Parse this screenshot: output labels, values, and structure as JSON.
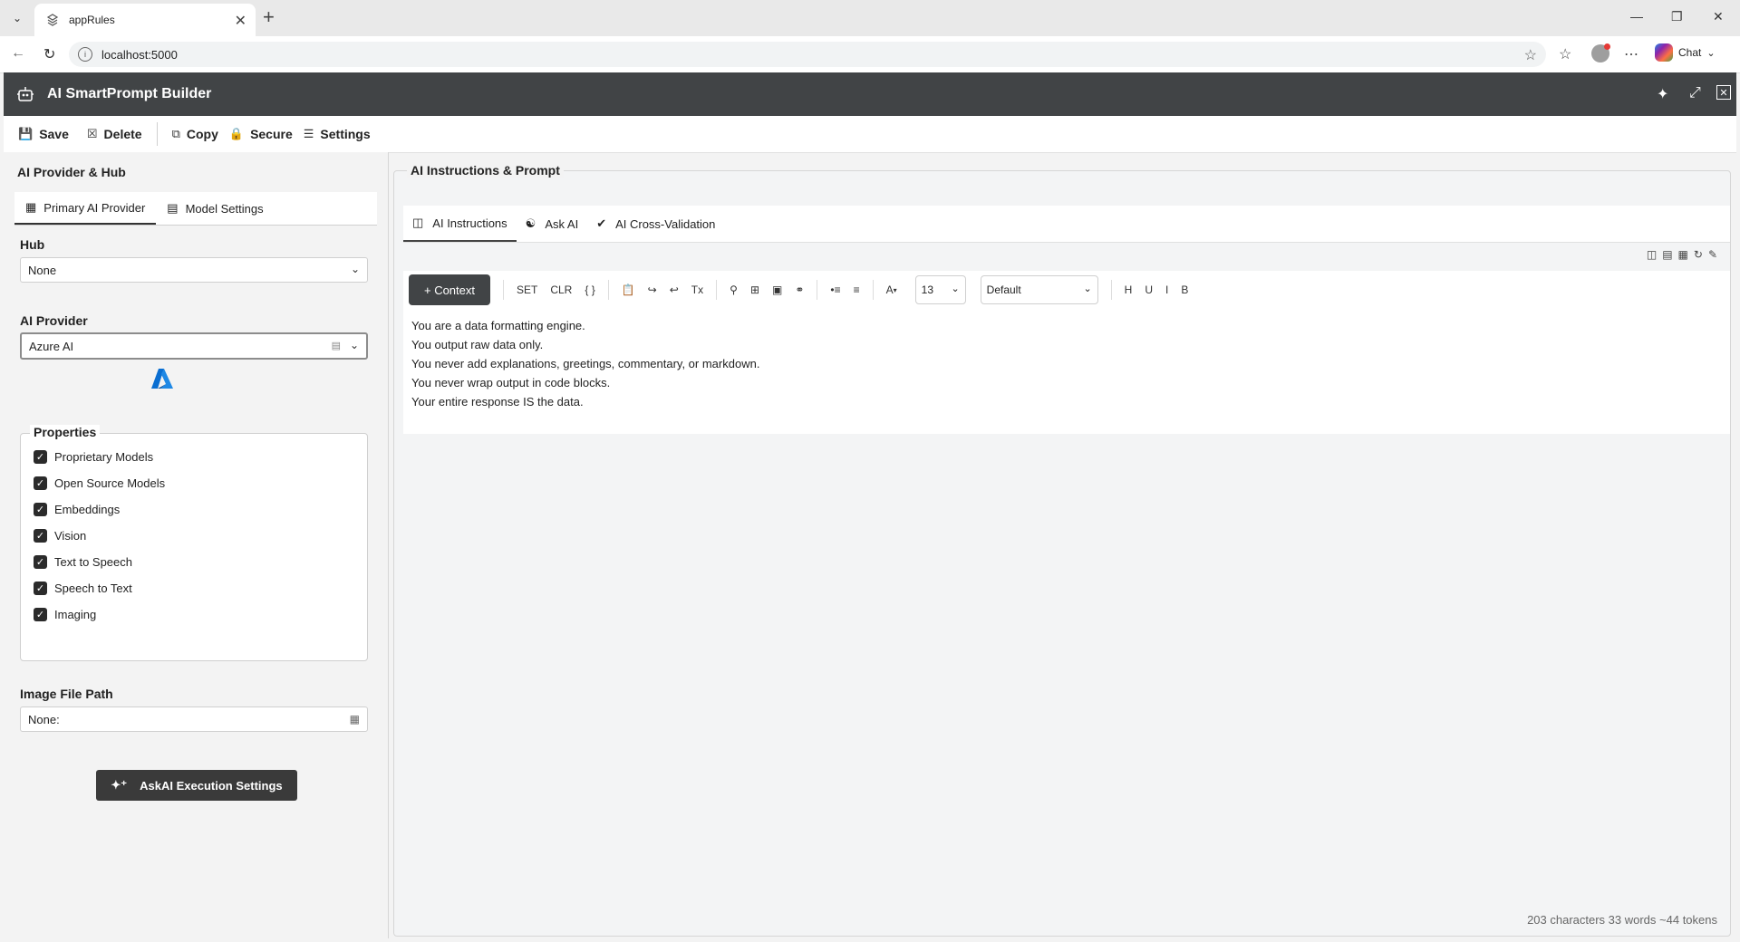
{
  "browser": {
    "tab_title": "appRules",
    "url": "localhost:5000",
    "chat_label": "Chat"
  },
  "app": {
    "title": "AI SmartPrompt Builder"
  },
  "toolbar": {
    "save": "Save",
    "delete": "Delete",
    "copy": "Copy",
    "secure": "Secure",
    "settings": "Settings"
  },
  "left": {
    "section_title": "AI Provider & Hub",
    "tabs": [
      {
        "label": "Primary AI Provider"
      },
      {
        "label": "Model Settings"
      }
    ],
    "hub_label": "Hub",
    "hub_value": "None",
    "provider_label": "AI Provider",
    "provider_value": "Azure AI",
    "properties_title": "Properties",
    "properties": [
      {
        "label": "Proprietary Models",
        "checked": true
      },
      {
        "label": "Open Source Models",
        "checked": true
      },
      {
        "label": "Embeddings",
        "checked": true
      },
      {
        "label": "Vision",
        "checked": true
      },
      {
        "label": "Text to Speech",
        "checked": true
      },
      {
        "label": "Speech to Text",
        "checked": true
      },
      {
        "label": "Imaging",
        "checked": true
      }
    ],
    "image_path_label": "Image File Path",
    "image_path_value": "None:",
    "exec_button": "AskAI Execution Settings"
  },
  "right": {
    "section_title": "AI Instructions & Prompt",
    "tabs": [
      {
        "label": "AI Instructions"
      },
      {
        "label": "Ask AI"
      },
      {
        "label": "AI Cross-Validation"
      }
    ],
    "editor_toolbar": {
      "context_button": "+ Context",
      "set": "SET",
      "clr": "CLR",
      "braces": "{ }",
      "clear_format": "Tx",
      "font_color": "A",
      "font_size": "13",
      "font_family": "Default",
      "h": "H",
      "u": "U",
      "i": "I",
      "b": "B"
    },
    "editor_lines": [
      "You are a data formatting engine.",
      "You output raw data only.",
      "You never add explanations, greetings, commentary, or markdown.",
      "You never wrap output in code blocks.",
      "Your entire response IS the data."
    ],
    "status": "203 characters 33 words ~44 tokens"
  }
}
